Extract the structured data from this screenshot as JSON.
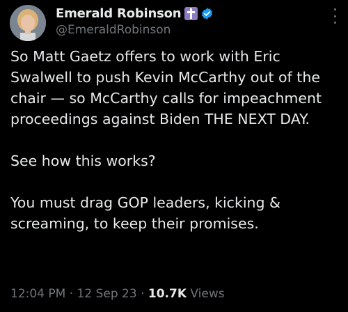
{
  "author": {
    "display_name": "Emerald Robinson",
    "handle": "@EmeraldRobinson",
    "badge_icon": "cross-icon",
    "verified_icon": "verified-badge-icon",
    "badge_color": "#8e7cc3",
    "verified_color": "#1d9bf0"
  },
  "tweet": {
    "paragraphs": [
      "So Matt Gaetz offers to work with Eric Swalwell to push Kevin McCarthy out of the chair — so McCarthy calls for impeachment proceedings against Biden THE NEXT DAY.",
      "See how this works?",
      "You must drag GOP leaders, kicking & screaming, to keep their promises."
    ]
  },
  "meta": {
    "time": "12:04 PM",
    "separator": "·",
    "date": "12 Sep 23",
    "views_count": "10.7K",
    "views_label": "Views"
  },
  "colors": {
    "background": "#000000",
    "text": "#e7e9ea",
    "secondary_text": "#71767b"
  }
}
